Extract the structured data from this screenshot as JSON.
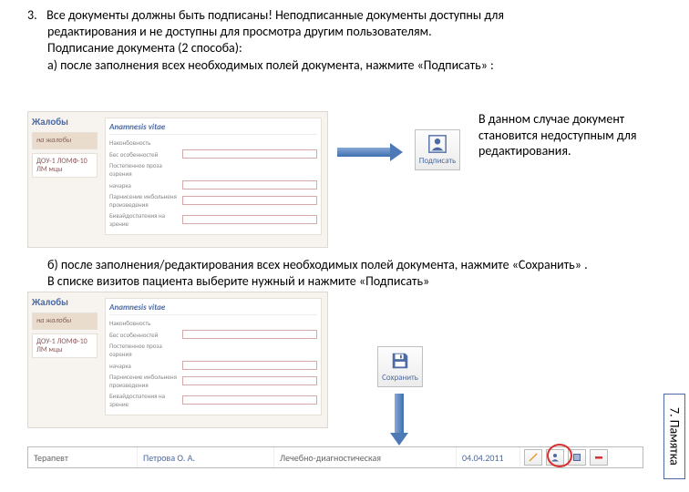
{
  "section_number": "3.",
  "main_text_line1": "Все документы должны быть подписаны! Неподписанные документы доступны для",
  "main_text_line2": "редактирования и не доступны для просмотра другим пользователям.",
  "main_text_line3": "Подписание документа (2 способа):",
  "main_text_line4": "а) после заполнения всех необходимых полей документа, нажмите «Подписать» :",
  "explanation": "В данном случае документ становится недоступным для редактирования.",
  "para_b_line1": "б) после заполнения/редактирования всех необходимых полей документа, нажмите «Сохранить» .",
  "para_b_line2": "В списке визитов пациента выберите нужный и нажмите «Подписать»",
  "sign_button_label": "Подписать",
  "save_button_label": "Сохранить",
  "thumb_title": "Жалобы",
  "thumb_form_title": "Anamnesis vitae",
  "thumb_side_row1": "на жалобы",
  "thumb_side_row2": "ДОУ-1 ЛОМФ-10 ЛМ мцы",
  "thumb_r1": "Наконбовность",
  "thumb_r2": "Бес особенностей",
  "thumb_r3": "Постепенное проза озрения",
  "thumb_r4": "начарка",
  "thumb_r5": "Парнисение инбольненя произведения",
  "thumb_r6": "Бивайдоспатения на зрение",
  "table": {
    "c1": "Терапевт",
    "c2": "Петрова О. А.",
    "c3": "Лечебно-диагностическая",
    "c4": "04.04.2011"
  },
  "sidetab": "7. Памятка"
}
